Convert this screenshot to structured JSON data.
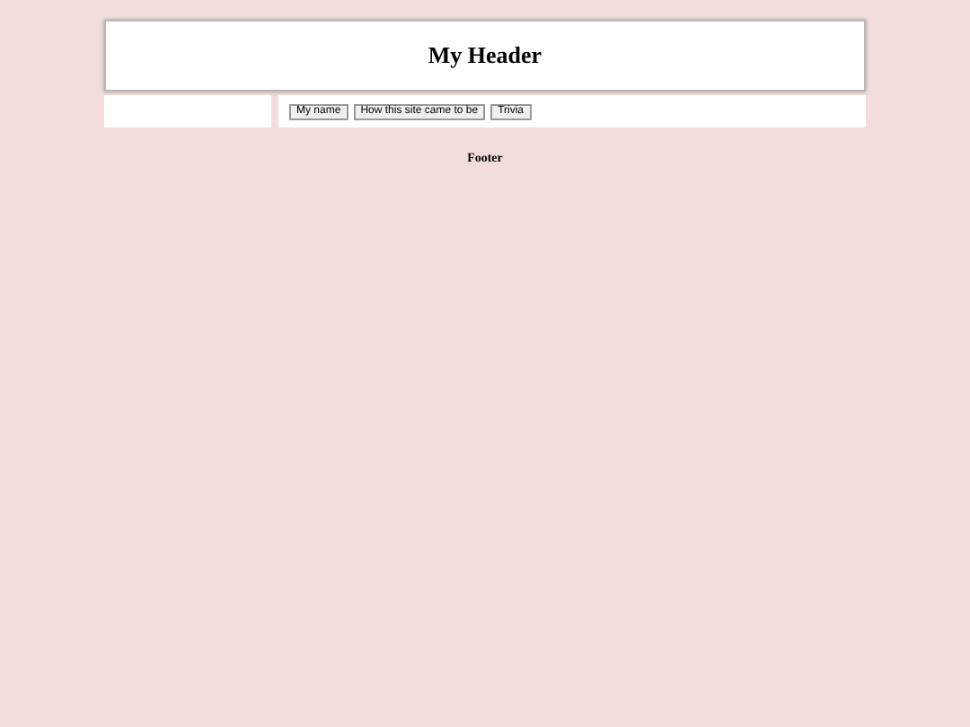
{
  "header": {
    "title": "My Header"
  },
  "buttons": [
    "My name",
    "How this site came to be",
    "Trivia"
  ],
  "footer": {
    "text": "Footer"
  }
}
